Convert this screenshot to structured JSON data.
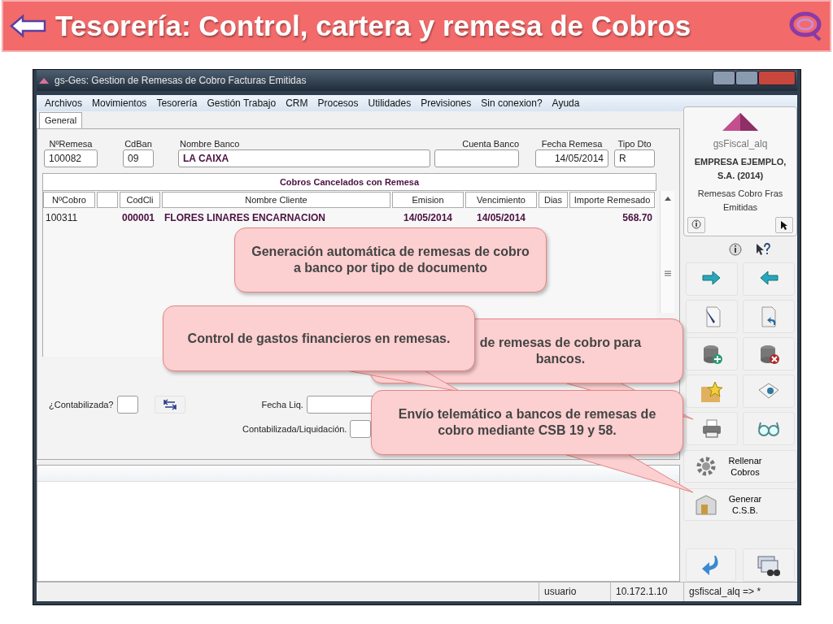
{
  "slide": {
    "title": "Tesorería: Control, cartera y remesa de Cobros"
  },
  "window": {
    "title": "gs-Ges: Gestion de Remesas de Cobro Facturas Emitidas"
  },
  "menu": [
    "Archivos",
    "Movimientos",
    "Tesorería",
    "Gestión Trabajo",
    "CRM",
    "Procesos",
    "Utilidades",
    "Previsiones",
    "Sin conexion?",
    "Ayuda"
  ],
  "tabs": [
    {
      "label": "General",
      "selected": true
    }
  ],
  "header_fields": [
    {
      "label": "NºRemesa",
      "value": "100082"
    },
    {
      "label": "CdBan",
      "value": "09"
    },
    {
      "label": "Nombre Banco",
      "value": "LA CAIXA"
    },
    {
      "label": "Cuenta Banco"
    },
    {
      "label": "Fecha Remesa",
      "value": "14/05/2014"
    },
    {
      "label": "Tipo Dto",
      "value": "R"
    }
  ],
  "table": {
    "title": "Cobros Cancelados con Remesa",
    "columns": [
      {
        "label": "NºCobro"
      },
      {},
      {
        "label": "CodCli"
      },
      {
        "label": "Nombre Cliente"
      },
      {
        "label": "Emision"
      },
      {
        "label": "Vencimiento"
      },
      {
        "label": "Dias"
      },
      {
        "label": "Importe Remesado"
      }
    ],
    "rows": [
      {
        "cells": [
          {
            "text": "100311"
          },
          {},
          {
            "text": "000001"
          },
          {
            "text": "FLORES LINARES ENCARNACION"
          },
          {
            "text": "14/05/2014"
          },
          {
            "text": "14/05/2014"
          },
          {},
          {
            "text": "568.70"
          }
        ]
      }
    ]
  },
  "bottom_fields": {
    "contabilizada": "¿Contabilizada?",
    "fecha_liq": "Fecha Liq.",
    "contab_liq": "Contabilizada/Liquidación."
  },
  "side_panel": {
    "app": "gsFiscal_alq",
    "company": "EMPRESA EJEMPLO, S.A. (2014)",
    "module": "Remesas Cobro Fras Emitidas",
    "buttons": [
      "Rellenar Cobros",
      "Generar C.S.B."
    ]
  },
  "status_bar": [
    "usuario",
    "10.172.1.10",
    "gsfiscal_alq => *"
  ],
  "callouts": [
    {
      "text": "Generación automática de remesas de cobro a banco por tipo de documento"
    },
    {
      "text": "Control de gastos financieros en remesas."
    },
    {
      "text": "de remesas de cobro para bancos."
    },
    {
      "text": "Envío telemático a bancos de remesas de cobro mediante CSB 19 y 58."
    }
  ]
}
